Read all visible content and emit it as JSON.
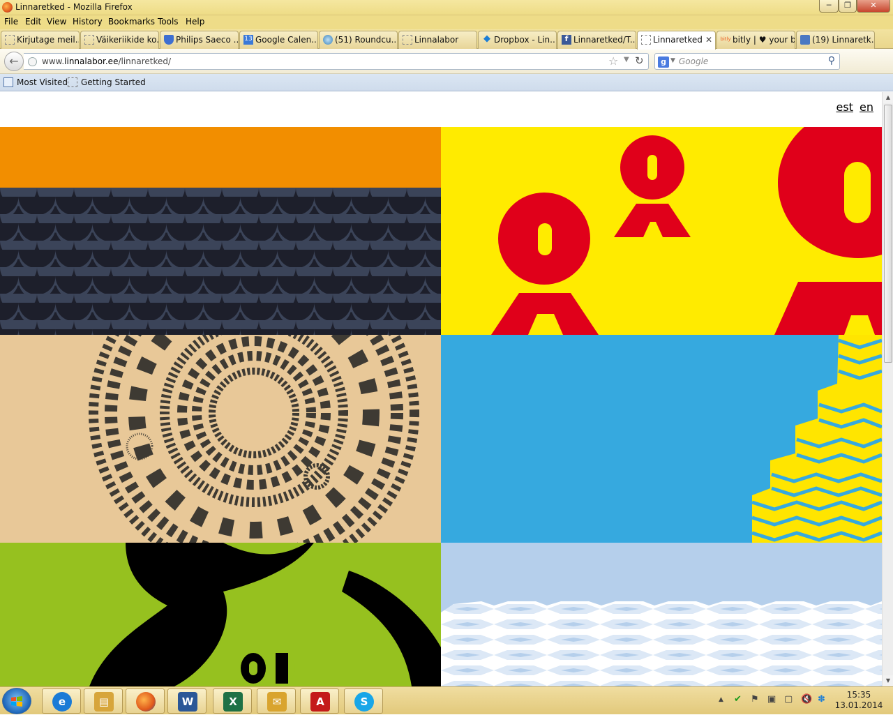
{
  "window": {
    "title": "Linnaretked - Mozilla Firefox",
    "minimize": "─",
    "restore": "❐",
    "close": "✕"
  },
  "menu": [
    "File",
    "Edit",
    "View",
    "History",
    "Bookmarks",
    "Tools",
    "Help"
  ],
  "tabs": [
    {
      "label": "Kirjutage meil...",
      "icon": "blank-page-icon"
    },
    {
      "label": "Väikeriikide ko...",
      "icon": "blank-page-icon"
    },
    {
      "label": "Philips Saeco ...",
      "icon": "shield-icon"
    },
    {
      "label": "Google Calen...",
      "icon": "calendar-icon",
      "icon_text": "13"
    },
    {
      "label": "(51) Roundcu...",
      "icon": "roundcube-icon"
    },
    {
      "label": "Linnalabor",
      "icon": "blank-page-icon"
    },
    {
      "label": "Dropbox - Lin...",
      "icon": "dropbox-icon"
    },
    {
      "label": "Linnaretked/T...",
      "icon": "facebook-icon",
      "icon_text": "f"
    },
    {
      "label": "Linnaretked",
      "icon": "blank-page-icon",
      "active": true,
      "close": "✕"
    },
    {
      "label": "bitly | ♥ your b...",
      "icon": "bitly-icon",
      "icon_text": "bitly"
    },
    {
      "label": "(19) Linnaretk...",
      "icon": "chat-icon"
    }
  ],
  "new_tab": "+",
  "nav": {
    "back": "←",
    "url_prefix": "www.",
    "url_domain": "linnalabor.ee",
    "url_path": "/linnaretked/",
    "star": "☆",
    "dropdown": "▼",
    "reload": "↻",
    "search_engine": "g",
    "search_dropdown": "▼",
    "search_placeholder": "Google",
    "search_btn": "⚲",
    "download": "⬇",
    "home": "⌂"
  },
  "bookmarks": [
    "Most Visited",
    "Getting Started"
  ],
  "page": {
    "lang": [
      "est",
      "en"
    ],
    "tiles": [
      {
        "name": "tile-orange-scales",
        "colors": [
          "#f28e00",
          "#1d1f2b",
          "#3b4459"
        ]
      },
      {
        "name": "tile-yellow-figures",
        "colors": [
          "#ffeb00",
          "#e0001a"
        ],
        "letters": "o"
      },
      {
        "name": "tile-beige-circles",
        "colors": [
          "#e8c898",
          "#3e3a33"
        ],
        "letters": "TFVUIL"
      },
      {
        "name": "tile-blue-zigzag",
        "colors": [
          "#36a9df",
          "#ffe500"
        ]
      },
      {
        "name": "tile-green-black",
        "colors": [
          "#96c11f",
          "#000000"
        ],
        "letters": "oi"
      },
      {
        "name": "tile-lightblue-pattern",
        "colors": [
          "#b5cfeb",
          "#ffffff"
        ]
      }
    ]
  },
  "taskbar": {
    "apps": [
      {
        "name": "internet-explorer-icon",
        "glyph": "e",
        "color": "#1a7bd6"
      },
      {
        "name": "file-explorer-icon",
        "glyph": "▤",
        "color": "#d7a53b"
      },
      {
        "name": "firefox-icon",
        "glyph": "●",
        "color": "#e26b1f"
      },
      {
        "name": "word-icon",
        "glyph": "W",
        "color": "#2b5797"
      },
      {
        "name": "excel-icon",
        "glyph": "X",
        "color": "#1e7145"
      },
      {
        "name": "outlook-icon",
        "glyph": "✉",
        "color": "#d9a42e"
      },
      {
        "name": "acrobat-icon",
        "glyph": "A",
        "color": "#c41a1a"
      },
      {
        "name": "skype-icon",
        "glyph": "S",
        "color": "#18a6e8"
      }
    ],
    "tray_icons": [
      "▲",
      "✔",
      "⚑",
      "▣",
      "▢",
      "🔇",
      "✽"
    ],
    "time": "15:35",
    "date": "13.01.2014"
  }
}
